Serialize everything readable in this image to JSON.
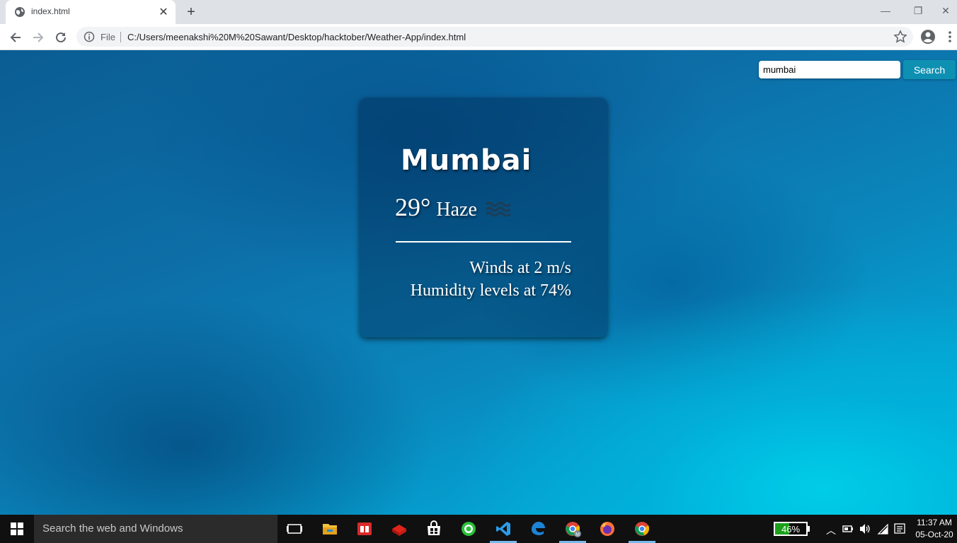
{
  "browser": {
    "tab_title": "index.html",
    "new_tab_symbol": "+",
    "url_scheme_label": "File",
    "url": "C:/Users/meenakshi%20M%20Sawant/Desktop/hacktober/Weather-App/index.html"
  },
  "search": {
    "value": "mumbai",
    "button_label": "Search"
  },
  "weather": {
    "city": "Mumbai",
    "temperature": "29°",
    "condition": "Haze",
    "condition_icon": "haze-icon",
    "winds": "Winds at 2 m/s",
    "humidity": "Humidity levels at 74%"
  },
  "taskbar": {
    "search_placeholder": "Search the web and Windows",
    "battery_percent": "46%",
    "battery_level": 0.46,
    "time": "11:37 AM",
    "date": "05-Oct-20"
  },
  "colors": {
    "search_button": "#0e90b3",
    "battery_fill": "#1ca01c"
  }
}
